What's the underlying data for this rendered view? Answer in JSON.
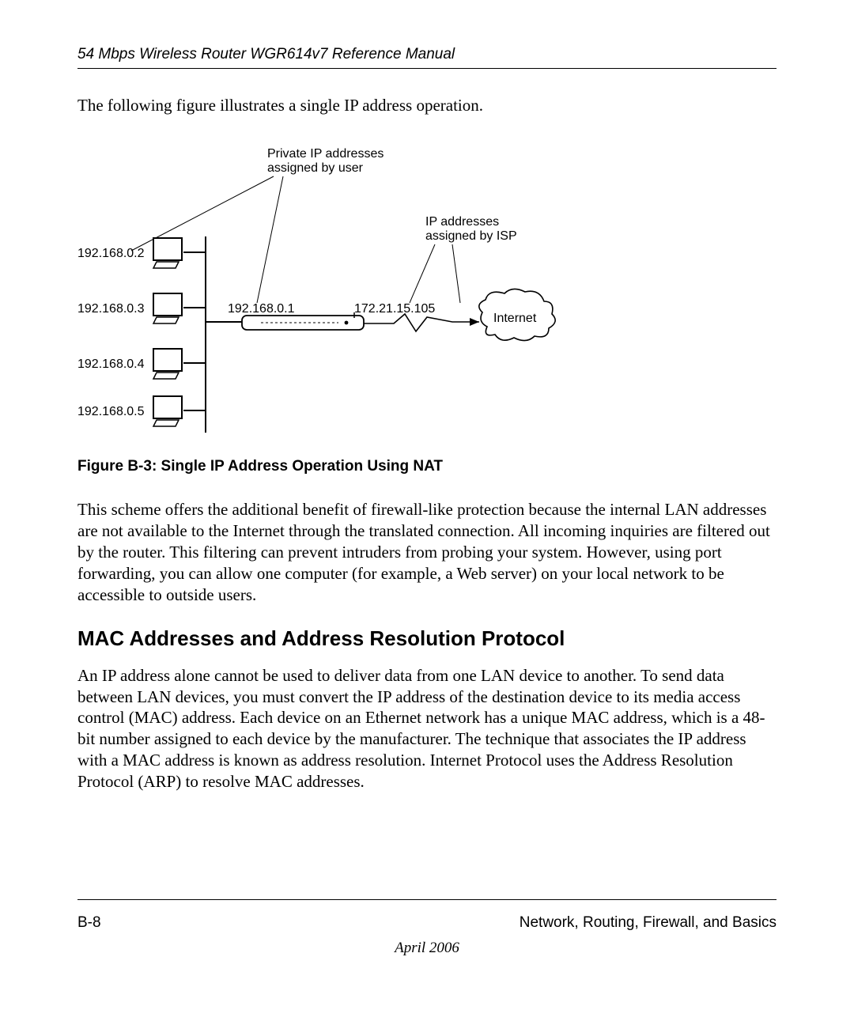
{
  "header": {
    "title": "54 Mbps Wireless Router WGR614v7 Reference Manual"
  },
  "intro": "The following figure illustrates a single IP address operation.",
  "figure": {
    "private_label_l1": "Private IP addresses",
    "private_label_l2": "assigned by user",
    "isp_label_l1": "IP addresses",
    "isp_label_l2": "assigned by ISP",
    "hosts": [
      "192.168.0.2",
      "192.168.0.3",
      "192.168.0.4",
      "192.168.0.5"
    ],
    "router_lan_ip": "192.168.0.1",
    "router_wan_ip": "172.21.15.105",
    "cloud_label": "Internet",
    "caption": "Figure B-3:   Single IP Address Operation Using NAT"
  },
  "para1": "This scheme offers the additional benefit of firewall-like protection because the internal LAN addresses are not available to the Internet through the translated connection. All incoming inquiries are filtered out by the router. This filtering can prevent intruders from probing your system. However, using port forwarding, you can allow one computer (for example, a Web server) on your local network to be accessible to outside users.",
  "section_heading": "MAC Addresses and Address Resolution Protocol",
  "para2": "An IP address alone cannot be used to deliver data from one LAN device to another. To send data between LAN devices, you must convert the IP address of the destination device to its media access control (MAC) address. Each device on an Ethernet network has a unique MAC address, which is a 48-bit number assigned to each device by the manufacturer. The technique that associates the IP address with a MAC address is known as address resolution. Internet Protocol uses the Address Resolution Protocol (ARP) to resolve MAC addresses.",
  "footer": {
    "page": "B-8",
    "section": "Network, Routing, Firewall, and Basics",
    "date": "April 2006"
  }
}
